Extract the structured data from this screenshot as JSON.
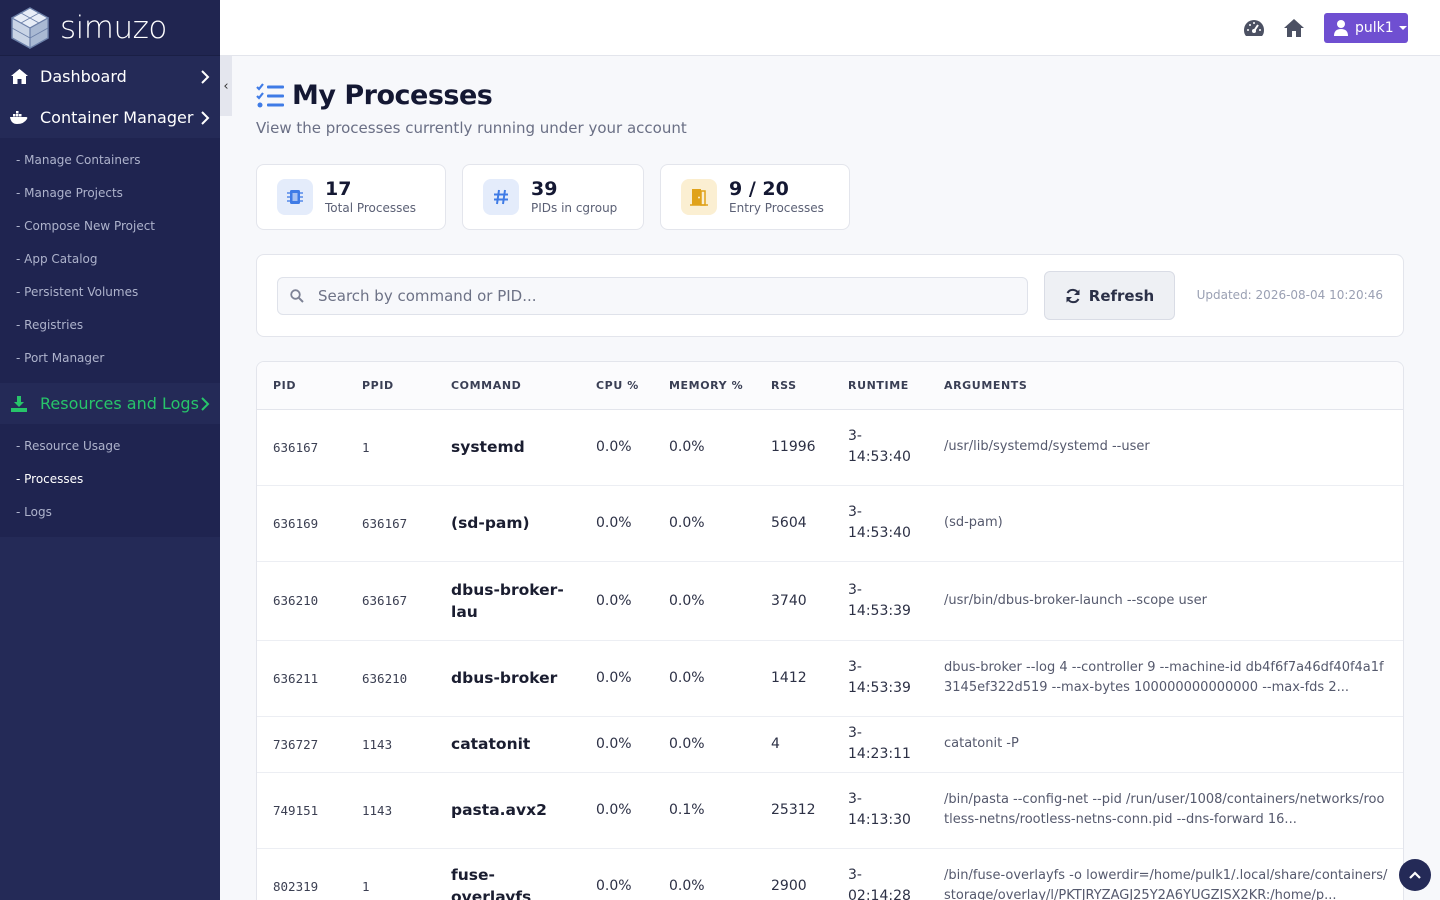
{
  "brand": {
    "name": "simuzo"
  },
  "sidebar": {
    "dashboard": {
      "label": "Dashboard",
      "icon": "home-icon"
    },
    "container_manager": {
      "label": "Container Manager",
      "icon": "docker-icon",
      "items": [
        {
          "label": "- Manage Containers"
        },
        {
          "label": "- Manage Projects"
        },
        {
          "label": "- Compose New Project"
        },
        {
          "label": "- App Catalog"
        },
        {
          "label": "- Persistent Volumes"
        },
        {
          "label": "- Registries"
        },
        {
          "label": "- Port Manager"
        }
      ]
    },
    "resources": {
      "label": "Resources and Logs",
      "icon": "download-icon",
      "color": "#27c56a",
      "items": [
        {
          "label": "- Resource Usage"
        },
        {
          "label": "- Processes",
          "active": true
        },
        {
          "label": "- Logs"
        }
      ]
    },
    "collapse_label": "‹"
  },
  "topbar": {
    "user_label": "pulk1",
    "accent": "#6f4fd1"
  },
  "page": {
    "title": "My Processes",
    "subtitle": "View the processes currently running under your account"
  },
  "stats": [
    {
      "value": "17",
      "label": "Total Processes",
      "icon": "chip-icon",
      "color": "#3f7be6"
    },
    {
      "value": "39",
      "label": "PIDs in cgroup",
      "icon": "hash-icon",
      "color": "#3f7be6"
    },
    {
      "value": "9 / 20",
      "label": "Entry Processes",
      "icon": "door-icon",
      "color": "#e0a21a"
    }
  ],
  "search": {
    "placeholder": "Search by command or PID...",
    "value": "",
    "refresh_label": "Refresh",
    "updated": "Updated: 2026-08-04 10:20:46"
  },
  "table": {
    "columns": [
      "PID",
      "PPID",
      "COMMAND",
      "CPU %",
      "MEMORY %",
      "RSS",
      "RUNTIME",
      "ARGUMENTS"
    ],
    "rows": [
      {
        "pid": "636167",
        "ppid": "1",
        "command": "systemd",
        "cpu": "0.0%",
        "mem": "0.0%",
        "rss": "11996",
        "runtime": "3-14:53:40",
        "args": "/usr/lib/systemd/systemd --user"
      },
      {
        "pid": "636169",
        "ppid": "636167",
        "command": "(sd-pam)",
        "cpu": "0.0%",
        "mem": "0.0%",
        "rss": "5604",
        "runtime": "3-14:53:40",
        "args": "(sd-pam)"
      },
      {
        "pid": "636210",
        "ppid": "636167",
        "command": "dbus-broker-lau",
        "cpu": "0.0%",
        "mem": "0.0%",
        "rss": "3740",
        "runtime": "3-14:53:39",
        "args": "/usr/bin/dbus-broker-launch --scope user"
      },
      {
        "pid": "636211",
        "ppid": "636210",
        "command": "dbus-broker",
        "cpu": "0.0%",
        "mem": "0.0%",
        "rss": "1412",
        "runtime": "3-14:53:39",
        "args": "dbus-broker --log 4 --controller 9 --machine-id db4f6f7a46df40f4a1f3145ef322d519 --max-bytes 100000000000000 --max-fds 2..."
      },
      {
        "pid": "736727",
        "ppid": "1143",
        "command": "catatonit",
        "cpu": "0.0%",
        "mem": "0.0%",
        "rss": "4",
        "runtime": "3-14:23:11",
        "args": "catatonit -P"
      },
      {
        "pid": "749151",
        "ppid": "1143",
        "command": "pasta.avx2",
        "cpu": "0.0%",
        "mem": "0.1%",
        "rss": "25312",
        "runtime": "3-14:13:30",
        "args": "/bin/pasta --config-net --pid /run/user/1008/containers/networks/rootless-netns/rootless-netns-conn.pid --dns-forward 16..."
      },
      {
        "pid": "802319",
        "ppid": "1",
        "command": "fuse-overlayfs",
        "cpu": "0.0%",
        "mem": "0.0%",
        "rss": "2900",
        "runtime": "3-02:14:28",
        "args": "/bin/fuse-overlayfs -o lowerdir=/home/pulk1/.local/share/containers/storage/overlay/l/PKTJRYZAGJ25Y2A6YUGZISX2KR:/home/p..."
      }
    ]
  }
}
